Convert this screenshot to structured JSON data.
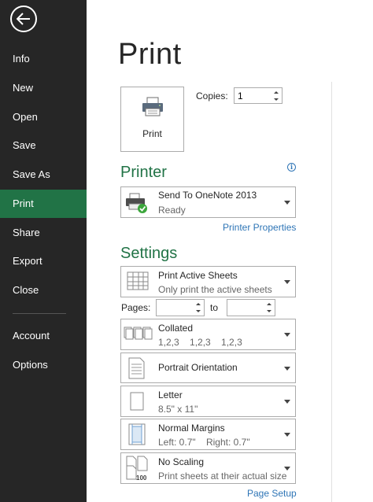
{
  "nav": {
    "back_icon": "back-arrow-icon",
    "items": [
      {
        "label": "Info"
      },
      {
        "label": "New"
      },
      {
        "label": "Open"
      },
      {
        "label": "Save"
      },
      {
        "label": "Save As"
      },
      {
        "label": "Print",
        "active": true
      },
      {
        "label": "Share"
      },
      {
        "label": "Export"
      },
      {
        "label": "Close"
      },
      {
        "label": "Account"
      },
      {
        "label": "Options"
      }
    ]
  },
  "main": {
    "title": "Print",
    "print_button_label": "Print",
    "copies_label": "Copies:",
    "copies_value": "1"
  },
  "printer": {
    "heading": "Printer",
    "name": "Send To OneNote 2013",
    "status": "Ready",
    "properties_link": "Printer Properties"
  },
  "settings": {
    "heading": "Settings",
    "active_sheets": {
      "title": "Print Active Sheets",
      "subtitle": "Only print the active sheets"
    },
    "pages_label": "Pages:",
    "to_label": "to",
    "collated": {
      "title": "Collated",
      "subtitle": "1,2,3    1,2,3    1,2,3"
    },
    "orientation": {
      "title": "Portrait Orientation"
    },
    "paper": {
      "title": "Letter",
      "subtitle": "8.5\" x 11\""
    },
    "margins": {
      "title": "Normal Margins",
      "subtitle": "Left: 0.7\"    Right: 0.7\""
    },
    "scaling": {
      "title": "No Scaling",
      "subtitle": "Print sheets at their actual size",
      "icon_text": "100"
    },
    "page_setup_link": "Page Setup"
  },
  "colors": {
    "nav_bg": "#262626",
    "accent_green": "#217346",
    "link_blue": "#2e75b6"
  }
}
